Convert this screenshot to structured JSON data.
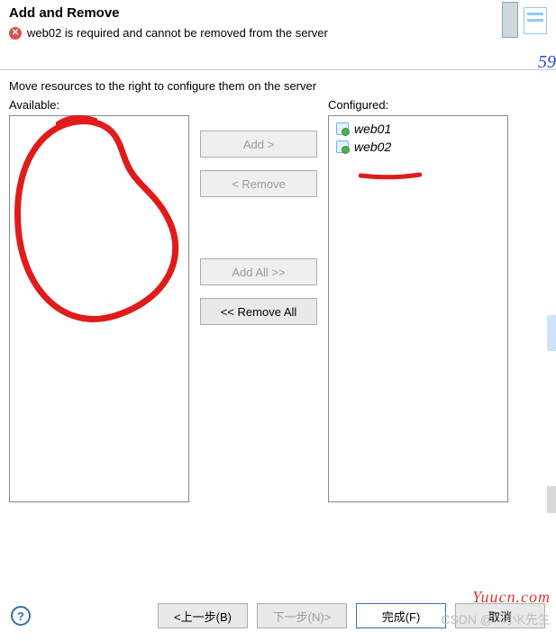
{
  "header": {
    "title": "Add and Remove",
    "error_message": "web02 is required and cannot be removed from the server"
  },
  "corner_number": "59",
  "instruction": "Move resources to the right to configure them on the server",
  "available": {
    "label": "Available:",
    "items": []
  },
  "configured": {
    "label": "Configured:",
    "items": [
      {
        "name": "web01"
      },
      {
        "name": "web02"
      }
    ]
  },
  "buttons": {
    "add": "Add >",
    "remove": "< Remove",
    "add_all": "Add All >>",
    "remove_all": "<< Remove All"
  },
  "footer": {
    "back": "<上一步(B)",
    "next": "下一步(N)>",
    "finish": "完成(F)",
    "cancel": "取消"
  },
  "watermark": {
    "site": "Yuucn.com",
    "author": "CSDN @☞小K先生"
  }
}
